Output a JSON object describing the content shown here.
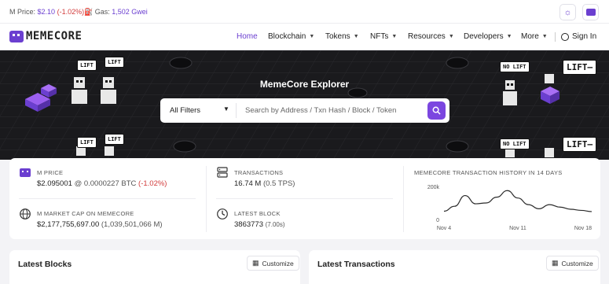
{
  "topbar": {
    "price_label": "M Price:",
    "price_value": "$2.10",
    "price_change": "(-1.02%)",
    "gas_label": "Gas:",
    "gas_value": "1,502 Gwei"
  },
  "nav": {
    "logo_text": "MEMECORE",
    "items": [
      {
        "label": "Home"
      },
      {
        "label": "Blockchain"
      },
      {
        "label": "Tokens"
      },
      {
        "label": "NFTs"
      },
      {
        "label": "Resources"
      },
      {
        "label": "Developers"
      },
      {
        "label": "More"
      }
    ],
    "signin": "Sign In"
  },
  "hero": {
    "title": "MemeCore Explorer",
    "filter": "All Filters",
    "search_placeholder": "Search by Address / Txn Hash / Block / Token",
    "bubbles": [
      "LIFT",
      "LIFT",
      "LIFT",
      "LIFT",
      "NO LIFT",
      "NO LIFT",
      "LIFT—",
      "LIFT—"
    ]
  },
  "stats": {
    "m_price_label": "M PRICE",
    "m_price_value": "$2.095001",
    "m_price_btc": "@ 0.0000227 BTC",
    "m_price_change": "(-1.02%)",
    "mcap_label": "M MARKET CAP ON MEMECORE",
    "mcap_value": "$2,177,755,697.00",
    "mcap_sub": "(1,039,501,066 M)",
    "tx_label": "TRANSACTIONS",
    "tx_value": "16.74 M",
    "tx_sub": "(0.5 TPS)",
    "block_label": "LATEST BLOCK",
    "block_value": "3863773",
    "block_sub": "(7.00s)",
    "chart_title": "MEMECORE TRANSACTION HISTORY IN 14 DAYS"
  },
  "chart_data": {
    "type": "line",
    "title": "MEMECORE TRANSACTION HISTORY IN 14 DAYS",
    "x": [
      "Nov 4",
      "Nov 5",
      "Nov 6",
      "Nov 7",
      "Nov 8",
      "Nov 9",
      "Nov 10",
      "Nov 11",
      "Nov 12",
      "Nov 13",
      "Nov 14",
      "Nov 15",
      "Nov 16",
      "Nov 17",
      "Nov 18"
    ],
    "xticks": [
      "Nov 4",
      "Nov 11",
      "Nov 18"
    ],
    "yticks": [
      "0",
      "200k"
    ],
    "series": [
      {
        "values": [
          50000,
          80000,
          145000,
          95000,
          100000,
          135000,
          175000,
          130000,
          90000,
          65000,
          90000,
          75000,
          62000,
          55000,
          48000
        ]
      }
    ],
    "ylim": [
      0,
      200000
    ],
    "color": "#2b2b2b"
  },
  "panels": {
    "blocks_title": "Latest Blocks",
    "tx_title": "Latest Transactions",
    "customize": "Customize"
  },
  "colors": {
    "accent": "#6b3fd0",
    "negative": "#d23b3b",
    "hero_bg": "#1a1a1d"
  }
}
